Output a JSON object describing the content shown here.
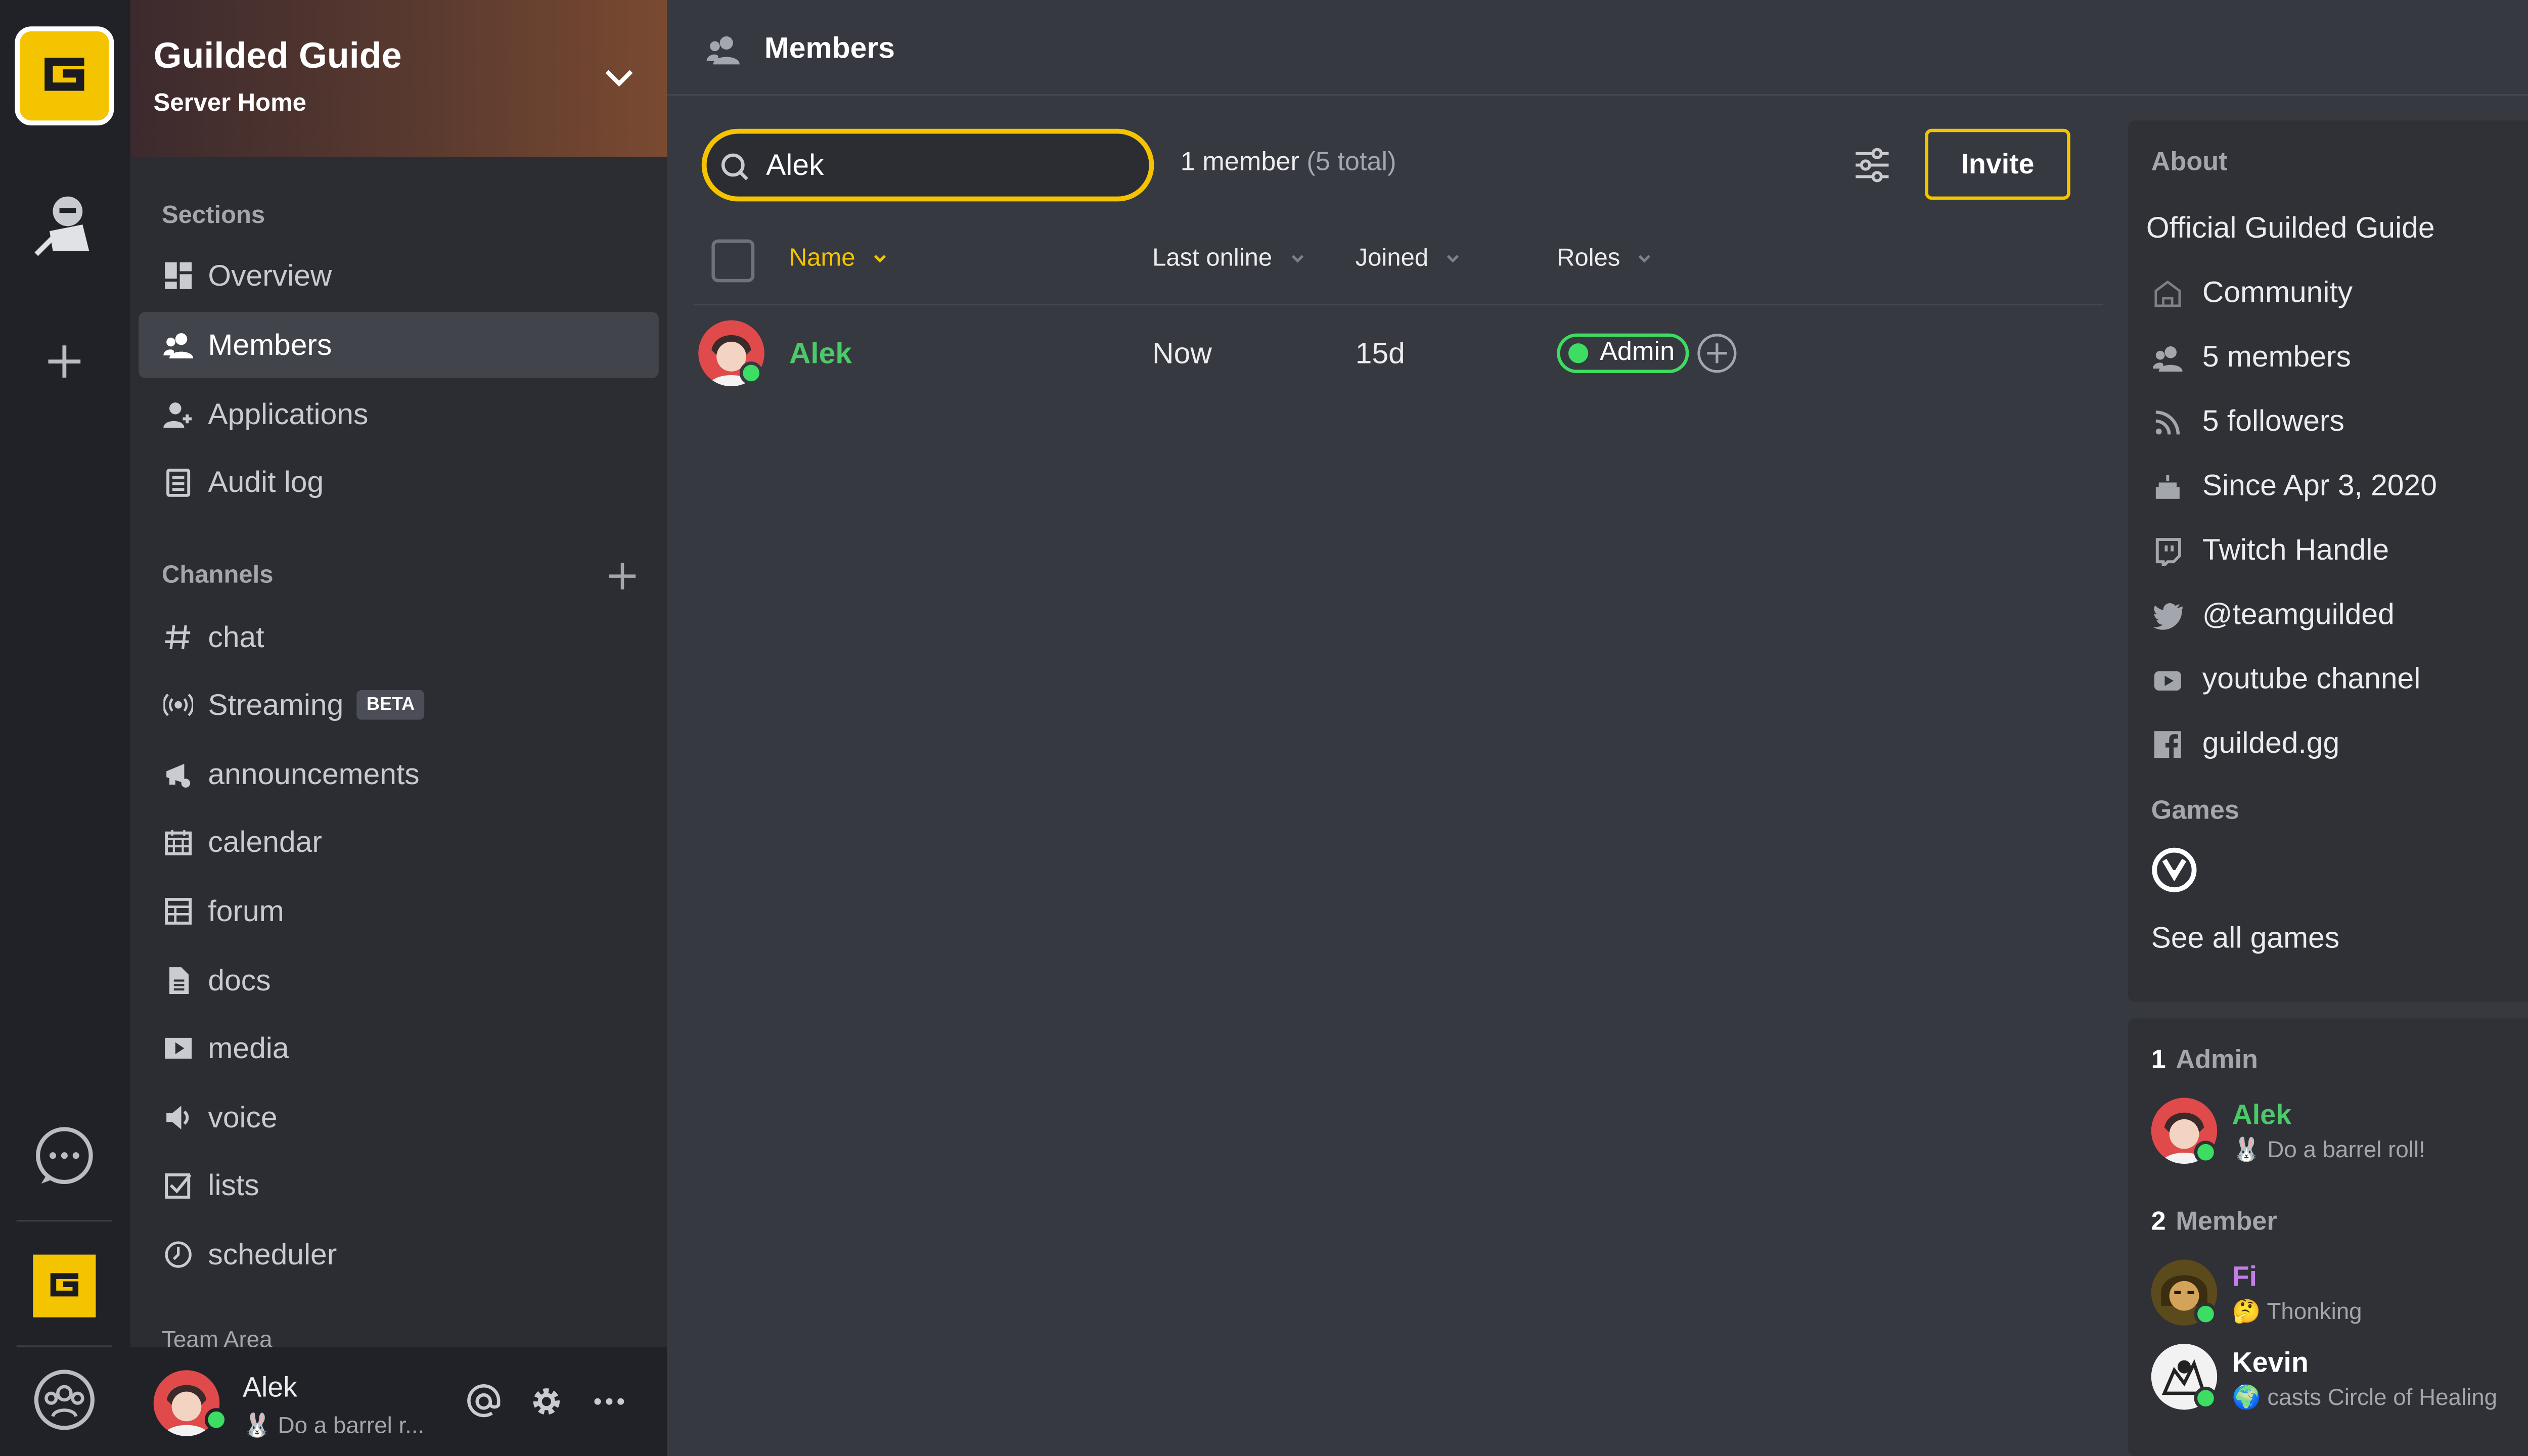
{
  "colors": {
    "accent": "#f5c400",
    "online": "#3ddc62",
    "admin_name": "#4cc968",
    "member_purple": "#c57ee8"
  },
  "server": {
    "title": "Guilded Guide",
    "subtitle": "Server Home"
  },
  "sidebar": {
    "sections_label": "Sections",
    "sections": [
      {
        "label": "Overview",
        "icon": "grid-icon"
      },
      {
        "label": "Members",
        "icon": "members-icon"
      },
      {
        "label": "Applications",
        "icon": "add-user-icon"
      },
      {
        "label": "Audit log",
        "icon": "clipboard-icon"
      }
    ],
    "channels_label": "Channels",
    "channels": [
      {
        "label": "chat",
        "icon": "hash-icon"
      },
      {
        "label": "Streaming",
        "icon": "broadcast-icon",
        "badge": "BETA"
      },
      {
        "label": "announcements",
        "icon": "megaphone-icon"
      },
      {
        "label": "calendar",
        "icon": "calendar-icon"
      },
      {
        "label": "forum",
        "icon": "forum-icon"
      },
      {
        "label": "docs",
        "icon": "doc-icon"
      },
      {
        "label": "media",
        "icon": "play-icon"
      },
      {
        "label": "voice",
        "icon": "speaker-icon"
      },
      {
        "label": "lists",
        "icon": "checkbox-icon"
      },
      {
        "label": "scheduler",
        "icon": "clock-icon"
      }
    ],
    "team_area": "Team Area"
  },
  "user_bar": {
    "name": "Alek",
    "status": "Do a barrel r..."
  },
  "header": {
    "title": "Members"
  },
  "search": {
    "value": "Alek",
    "placeholder": "Search"
  },
  "member_count": {
    "main": "1 member",
    "total": "(5 total)"
  },
  "invite_label": "Invite",
  "table": {
    "columns": [
      "Name",
      "Last online",
      "Joined",
      "Roles"
    ],
    "rows": [
      {
        "name": "Alek",
        "last_online": "Now",
        "joined": "15d",
        "role": "Admin"
      }
    ]
  },
  "about": {
    "label": "About",
    "title": "Official Guilded Guide",
    "items": [
      {
        "label": "Community",
        "icon": "building-icon"
      },
      {
        "label": "5 members",
        "icon": "members-icon"
      },
      {
        "label": "5 followers",
        "icon": "rss-icon"
      },
      {
        "label": "Since Apr 3, 2020",
        "icon": "cake-icon"
      },
      {
        "label": "Twitch Handle",
        "icon": "twitch-icon"
      },
      {
        "label": "@teamguilded",
        "icon": "twitter-icon"
      },
      {
        "label": "youtube channel",
        "icon": "youtube-icon"
      },
      {
        "label": "guilded.gg",
        "icon": "facebook-icon"
      }
    ],
    "games_label": "Games",
    "see_all": "See all games"
  },
  "member_list": {
    "groups": [
      {
        "count": "1",
        "label": "Admin",
        "members": [
          {
            "name": "Alek",
            "status": "Do a barrel roll!"
          }
        ]
      },
      {
        "count": "2",
        "label": "Member",
        "members": [
          {
            "name": "Fi",
            "status": "Thonking"
          },
          {
            "name": "Kevin",
            "status": "casts Circle of Healing"
          }
        ]
      }
    ]
  }
}
